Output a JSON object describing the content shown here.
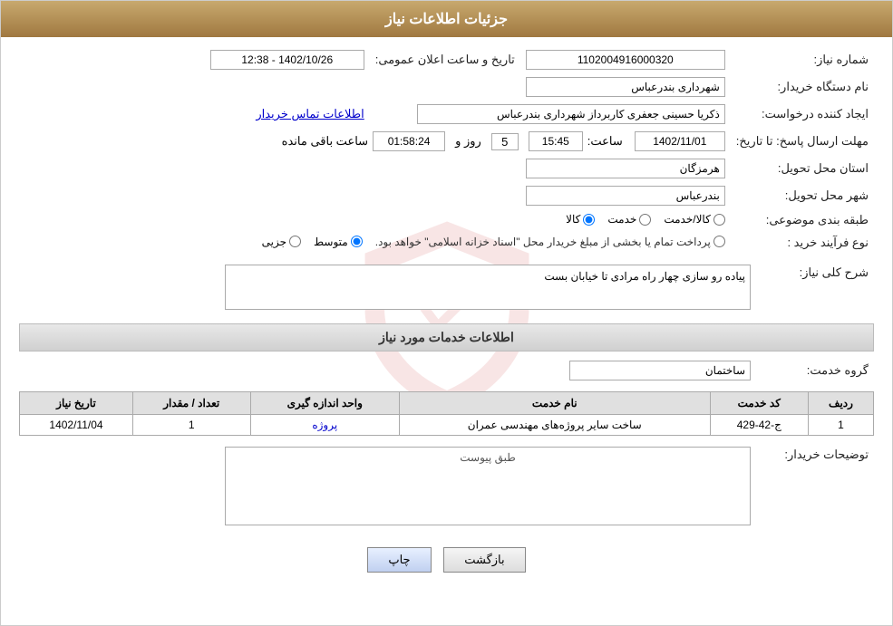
{
  "header": {
    "title": "جزئیات اطلاعات نیاز"
  },
  "form": {
    "need_number_label": "شماره نیاز:",
    "need_number_value": "1102004916000320",
    "announce_datetime_label": "تاریخ و ساعت اعلان عمومی:",
    "announce_datetime_value": "1402/10/26 - 12:38",
    "buyer_org_label": "نام دستگاه خریدار:",
    "buyer_org_value": "شهرداری بندرعباس",
    "creator_label": "ایجاد کننده درخواست:",
    "creator_value": "ذکریا حسینی جعفری کاربرداز شهرداری بندرعباس",
    "contact_link": "اطلاعات تماس خریدار",
    "deadline_label": "مهلت ارسال پاسخ: تا تاریخ:",
    "deadline_date_value": "1402/11/01",
    "deadline_time_label": "ساعت:",
    "deadline_time_value": "15:45",
    "deadline_days_label": "روز و",
    "deadline_days_value": "5",
    "deadline_remaining_label": "ساعت باقی مانده",
    "deadline_remaining_value": "01:58:24",
    "province_label": "استان محل تحویل:",
    "province_value": "هرمزگان",
    "city_label": "شهر محل تحویل:",
    "city_value": "بندرعباس",
    "category_label": "طبقه بندی موضوعی:",
    "category_options": [
      "کالا",
      "خدمت",
      "کالا/خدمت"
    ],
    "category_selected": "کالا",
    "purchase_type_label": "نوع فرآیند خرید :",
    "purchase_type_options": [
      "جزیی",
      "متوسط",
      "پرداخت تمام یا بخشی از مبلغ خریدار محل \"اسناد خزانه اسلامی\" خواهد بود."
    ],
    "purchase_type_selected": "متوسط",
    "description_label": "شرح کلی نیاز:",
    "description_value": "پیاده رو سازی چهار راه مرادی تا خیابان بست",
    "services_section": "اطلاعات خدمات مورد نیاز",
    "service_group_label": "گروه خدمت:",
    "service_group_value": "ساختمان",
    "table": {
      "headers": [
        "ردیف",
        "کد خدمت",
        "نام خدمت",
        "واحد اندازه گیری",
        "تعداد / مقدار",
        "تاریخ نیاز"
      ],
      "rows": [
        {
          "row_num": "1",
          "service_code": "ج-42-429",
          "service_name": "ساخت سایر پروژه‌های مهندسی عمران",
          "unit": "پروژه",
          "quantity": "1",
          "date": "1402/11/04"
        }
      ]
    },
    "buyer_notes_label": "توضیحات خریدار:",
    "buyer_notes_placeholder": "طبق پیوست"
  },
  "buttons": {
    "print_label": "چاپ",
    "back_label": "بازگشت"
  }
}
